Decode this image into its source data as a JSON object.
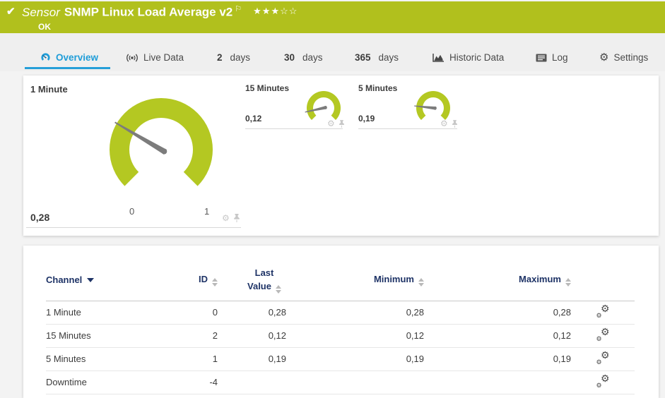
{
  "header": {
    "type_label": "Sensor",
    "title": "SNMP Linux Load Average v2",
    "flag": "⚐",
    "rating_stars": "★★★☆☆",
    "status": "OK",
    "check_mark": "✔"
  },
  "tabs": {
    "overview": {
      "label": "Overview"
    },
    "live_data": {
      "label": "Live Data"
    },
    "days2": {
      "num": "2",
      "label": "days"
    },
    "days30": {
      "num": "30",
      "label": "days"
    },
    "days365": {
      "num": "365",
      "label": "days"
    },
    "historic": {
      "label": "Historic Data"
    },
    "log": {
      "label": "Log"
    },
    "settings": {
      "label": "Settings"
    }
  },
  "gauges": {
    "primary": {
      "name": "1 Minute",
      "value": 0.28,
      "value_display": "0,28",
      "min": 0,
      "max": 1,
      "min_label": "0",
      "max_label": "1"
    },
    "minutes15": {
      "name": "15 Minutes",
      "value": 0.12,
      "value_display": "0,12",
      "min": 0,
      "max": 1
    },
    "minutes5": {
      "name": "5 Minutes",
      "value": 0.19,
      "value_display": "0,19",
      "min": 0,
      "max": 1
    }
  },
  "table": {
    "headers": {
      "channel": "Channel",
      "id": "ID",
      "last_value": "Last Value",
      "minimum": "Minimum",
      "maximum": "Maximum"
    },
    "rows": [
      {
        "channel": "1 Minute",
        "id": "0",
        "last_value": "0,28",
        "minimum": "0,28",
        "maximum": "0,28"
      },
      {
        "channel": "15 Minutes",
        "id": "2",
        "last_value": "0,12",
        "minimum": "0,12",
        "maximum": "0,12"
      },
      {
        "channel": "5 Minutes",
        "id": "1",
        "last_value": "0,19",
        "minimum": "0,19",
        "maximum": "0,19"
      },
      {
        "channel": "Downtime",
        "id": "-4",
        "last_value": "",
        "minimum": "",
        "maximum": ""
      }
    ]
  },
  "colors": {
    "brand_green": "#b1c01d",
    "gauge_green": "#b4c822",
    "active_tab_blue": "#1f9dd8",
    "table_header_navy": "#1e3366",
    "status_text": "#ffffff"
  }
}
